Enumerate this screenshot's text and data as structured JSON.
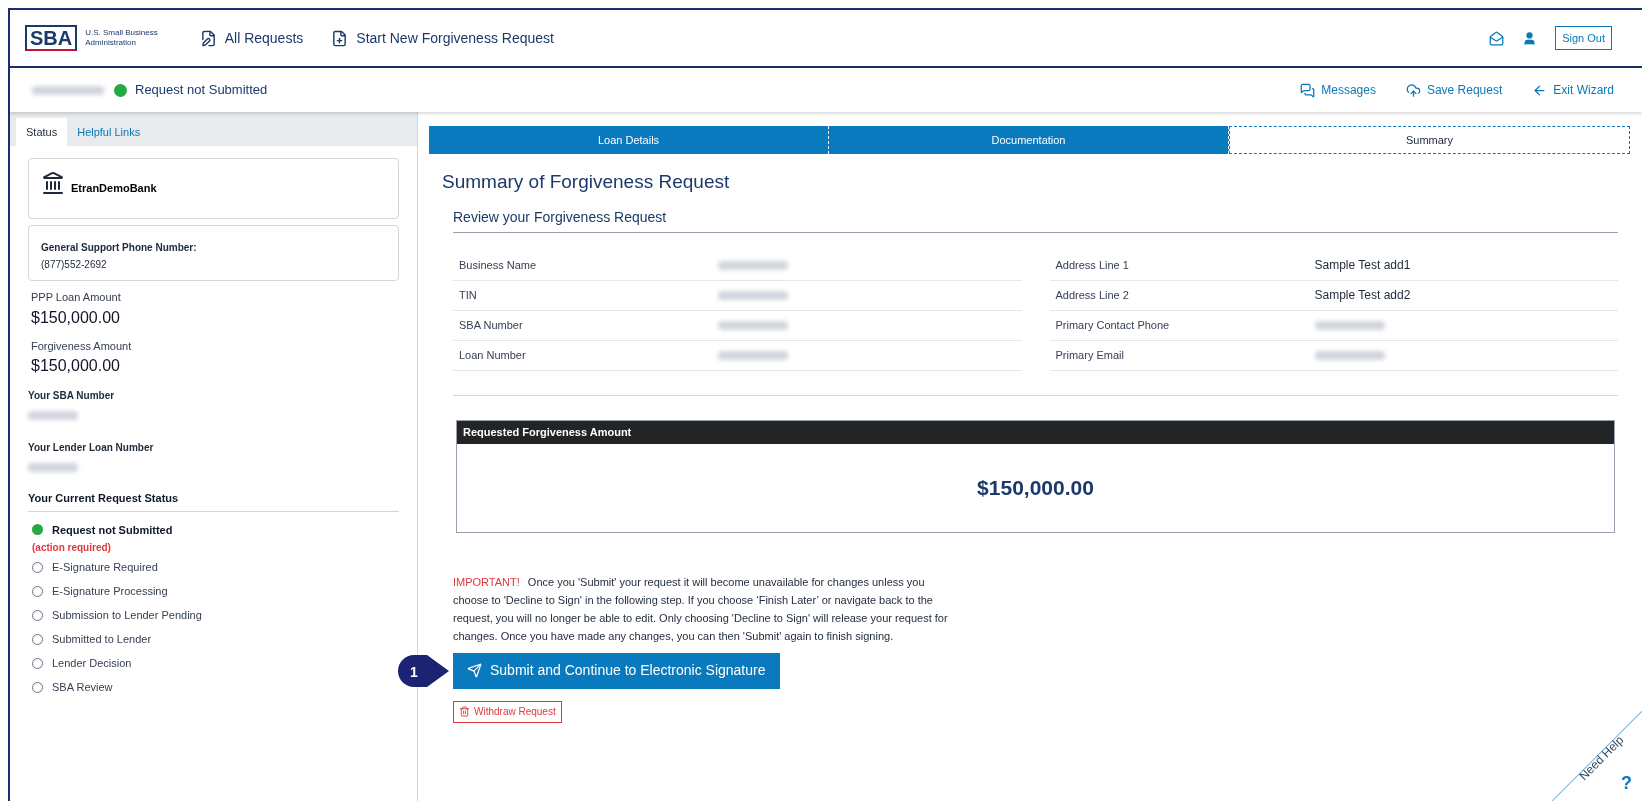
{
  "header": {
    "logo": {
      "mark": "SBA",
      "lines": [
        "U.S. Small Business",
        "Administration"
      ]
    },
    "nav": [
      {
        "kind": "requests",
        "label": "All Requests"
      },
      {
        "kind": "new",
        "label": "Start New Forgiveness Request"
      }
    ],
    "sign_out": "Sign Out"
  },
  "request_bar": {
    "name_redacted": true,
    "status": "Request not Submitted",
    "actions": [
      {
        "kind": "messages",
        "label": "Messages"
      },
      {
        "kind": "save",
        "label": "Save Request"
      },
      {
        "kind": "exit",
        "label": "Exit Wizard"
      }
    ]
  },
  "sidebar": {
    "tabs": [
      {
        "label": "Status",
        "selected": true
      },
      {
        "label": "Helpful Links",
        "selected": false
      }
    ],
    "bank": "EtranDemoBank",
    "support": {
      "label": "General Support Phone Number:",
      "phone": "(877)552-2692"
    },
    "amounts": [
      {
        "label": "PPP Loan Amount",
        "value": "$150,000.00"
      },
      {
        "label": "Forgiveness Amount",
        "value": "$150,000.00"
      }
    ],
    "numbers": [
      {
        "label": "Your SBA Number",
        "redacted": true
      },
      {
        "label": "Your Lender Loan Number",
        "redacted": true
      }
    ],
    "status_title": "Your Current Request Status",
    "statuses": [
      {
        "label": "Request not Submitted",
        "current": true,
        "note": "(action required)"
      },
      {
        "label": "E-Signature Required",
        "current": false
      },
      {
        "label": "E-Signature Processing",
        "current": false
      },
      {
        "label": "Submission to Lender Pending",
        "current": false
      },
      {
        "label": "Submitted to Lender",
        "current": false
      },
      {
        "label": "Lender Decision",
        "current": false
      },
      {
        "label": "SBA Review",
        "current": false
      }
    ]
  },
  "main": {
    "steps": [
      {
        "label": "Loan Details",
        "selected": false
      },
      {
        "label": "Documentation",
        "selected": false
      },
      {
        "label": "Summary",
        "selected": true
      }
    ],
    "title": "Summary of Forgiveness Request",
    "subtitle": "Review your Forgiveness Request",
    "left_rows": [
      {
        "label": "Business Name",
        "redacted": true
      },
      {
        "label": "TIN",
        "redacted": true
      },
      {
        "label": "SBA Number",
        "redacted": true
      },
      {
        "label": "Loan Number",
        "redacted": true
      }
    ],
    "right_rows": [
      {
        "label": "Address Line 1",
        "value": "Sample Test add1",
        "redacted": false
      },
      {
        "label": "Address Line 2",
        "value": "Sample Test add2",
        "redacted": false
      },
      {
        "label": "Primary Contact Phone",
        "redacted": true
      },
      {
        "label": "Primary Email",
        "redacted": true
      }
    ],
    "amount_box": {
      "title": "Requested Forgiveness Amount",
      "value": "$150,000.00"
    },
    "notice": {
      "label": "IMPORTANT!",
      "text": "Once you 'Submit' your request it will become unavailable for changes unless you choose to 'Decline to Sign' in the following step. If you choose ‘Finish Later’ or navigate back to the request, you will no longer be able to edit. Only choosing 'Decline to Sign' will release your request for changes. Once you have made any changes, you can then 'Submit' again to finish signing."
    },
    "callout": "1",
    "submit": "Submit and Continue to Electronic Signature",
    "withdraw": "Withdraw Request"
  },
  "help": {
    "label": "Need Help",
    "mark": "?"
  }
}
